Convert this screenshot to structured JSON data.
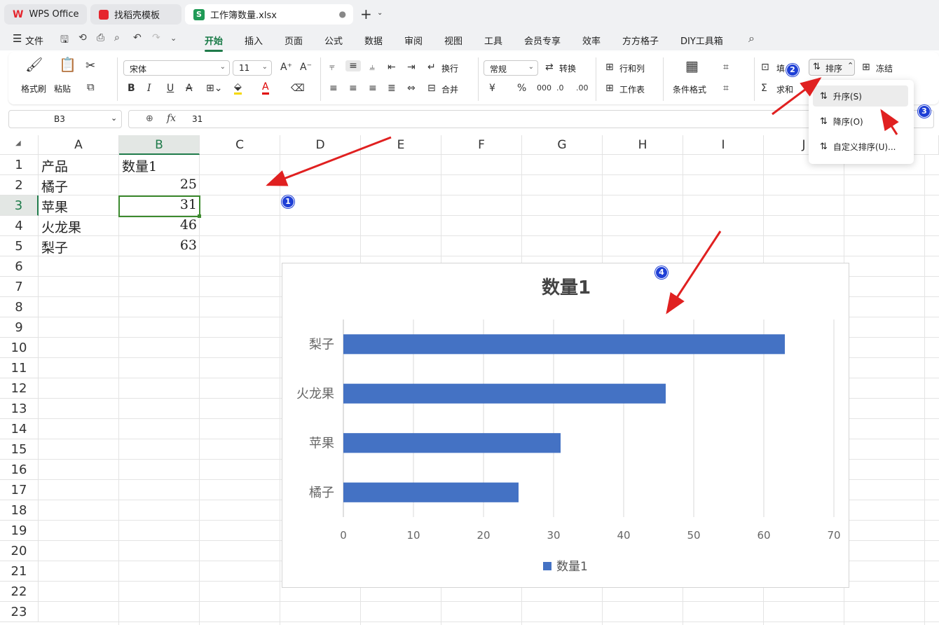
{
  "tabs": [
    {
      "label": "WPS Office",
      "icon": "wps-logo-icon"
    },
    {
      "label": "找稻壳模板",
      "icon": "docer-icon"
    },
    {
      "label": "工作簿数量.xlsx",
      "icon": "sheet-icon"
    }
  ],
  "tab_new": "+",
  "menu": {
    "file": "文件",
    "items": [
      "开始",
      "插入",
      "页面",
      "公式",
      "数据",
      "审阅",
      "视图",
      "工具",
      "会员专享",
      "效率",
      "方方格子",
      "DIY工具箱"
    ],
    "active": "开始"
  },
  "ribbon": {
    "format_painter": "格式刷",
    "paste": "粘贴",
    "font_name": "宋体",
    "font_size": "11",
    "wrap": "换行",
    "merge": "合并",
    "number_format": "常规",
    "convert": "转换",
    "row_col": "行和列",
    "worksheet": "工作表",
    "cond_format": "条件格式",
    "fill": "填",
    "sum": "求和",
    "sort": "排序",
    "freeze": "冻结",
    "bold": "B",
    "italic": "I",
    "underline": "U",
    "font_color": "A",
    "percent": "%",
    "currency": "¥"
  },
  "sort_menu": {
    "items": [
      "升序(S)",
      "降序(O)",
      "自定义排序(U)..."
    ]
  },
  "formula_bar": {
    "cell_ref": "B3",
    "fx": "fx",
    "value": "31"
  },
  "sheet": {
    "columns": [
      "A",
      "B",
      "C",
      "D",
      "E",
      "F",
      "G",
      "H",
      "I",
      "J"
    ],
    "rows": [
      "1",
      "2",
      "3",
      "4",
      "5",
      "6",
      "7",
      "8",
      "9",
      "10",
      "11",
      "12",
      "13",
      "14",
      "15",
      "16",
      "17",
      "18",
      "19",
      "20",
      "21",
      "22",
      "23"
    ],
    "header": [
      "产品",
      "数量1"
    ],
    "data": [
      [
        "橘子",
        "25"
      ],
      [
        "苹果",
        "31"
      ],
      [
        "火龙果",
        "46"
      ],
      [
        "梨子",
        "63"
      ]
    ]
  },
  "badges": [
    "1",
    "2",
    "3",
    "4"
  ],
  "chart_data": {
    "type": "bar",
    "orientation": "horizontal",
    "title": "数量1",
    "categories": [
      "橘子",
      "苹果",
      "火龙果",
      "梨子"
    ],
    "series": [
      {
        "name": "数量1",
        "values": [
          25,
          31,
          46,
          63
        ],
        "color": "#4472c4"
      }
    ],
    "xlim": [
      0,
      70
    ],
    "xticks": [
      "0",
      "10",
      "20",
      "30",
      "40",
      "50",
      "60",
      "70"
    ],
    "grid": true,
    "legend": "bottom"
  },
  "colors": {
    "accent": "#1f7b4a",
    "selection": "#2e7d32",
    "bar": "#4472c4",
    "badge": "#1e3fd6",
    "arrow": "#e02020"
  }
}
